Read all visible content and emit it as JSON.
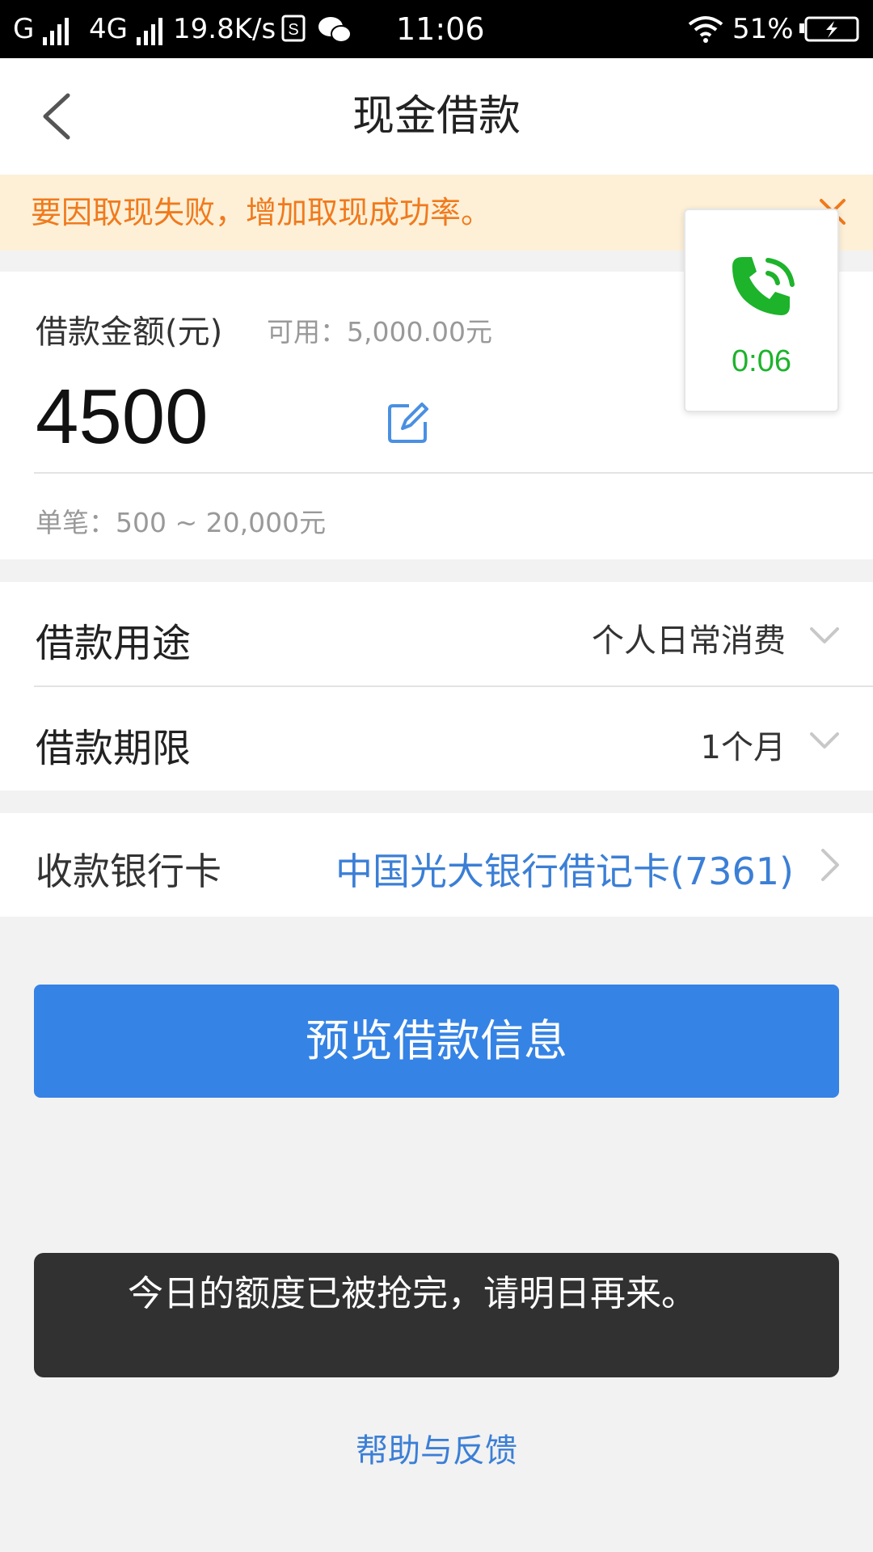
{
  "status_bar": {
    "carrier1": "G",
    "carrier2": "4G",
    "speed": "19.8K/s",
    "time": "11:06",
    "battery": "51%"
  },
  "header": {
    "title": "现金借款"
  },
  "notice": {
    "text": "要因取现失败，增加取现成功率。"
  },
  "call_widget": {
    "duration": "0:06",
    "color": "#1db32b"
  },
  "amount": {
    "label": "借款金额(元)",
    "available": "可用：5,000.00元",
    "value": "4500",
    "range": "单笔：500 ~ 20,000元"
  },
  "purpose": {
    "label": "借款用途",
    "value": "个人日常消费"
  },
  "term": {
    "label": "借款期限",
    "value": "1个月"
  },
  "bank_card": {
    "label": "收款银行卡",
    "value": "中国光大银行借记卡(7361)"
  },
  "preview_button": {
    "label": "预览借款信息",
    "color": "#3583e5"
  },
  "toast": {
    "message": "今日的额度已被抢完，请明日再来。"
  },
  "help_link": {
    "label": "帮助与反馈"
  },
  "icons": {
    "back": "chevron-left-icon",
    "close": "close-icon",
    "edit": "edit-icon",
    "dropdown": "chevron-down-icon",
    "navigate": "chevron-right-icon",
    "phone": "phone-call-icon",
    "wifi": "wifi-icon",
    "battery": "battery-charging-icon",
    "wechat": "wechat-icon",
    "sim": "sim-icon"
  }
}
